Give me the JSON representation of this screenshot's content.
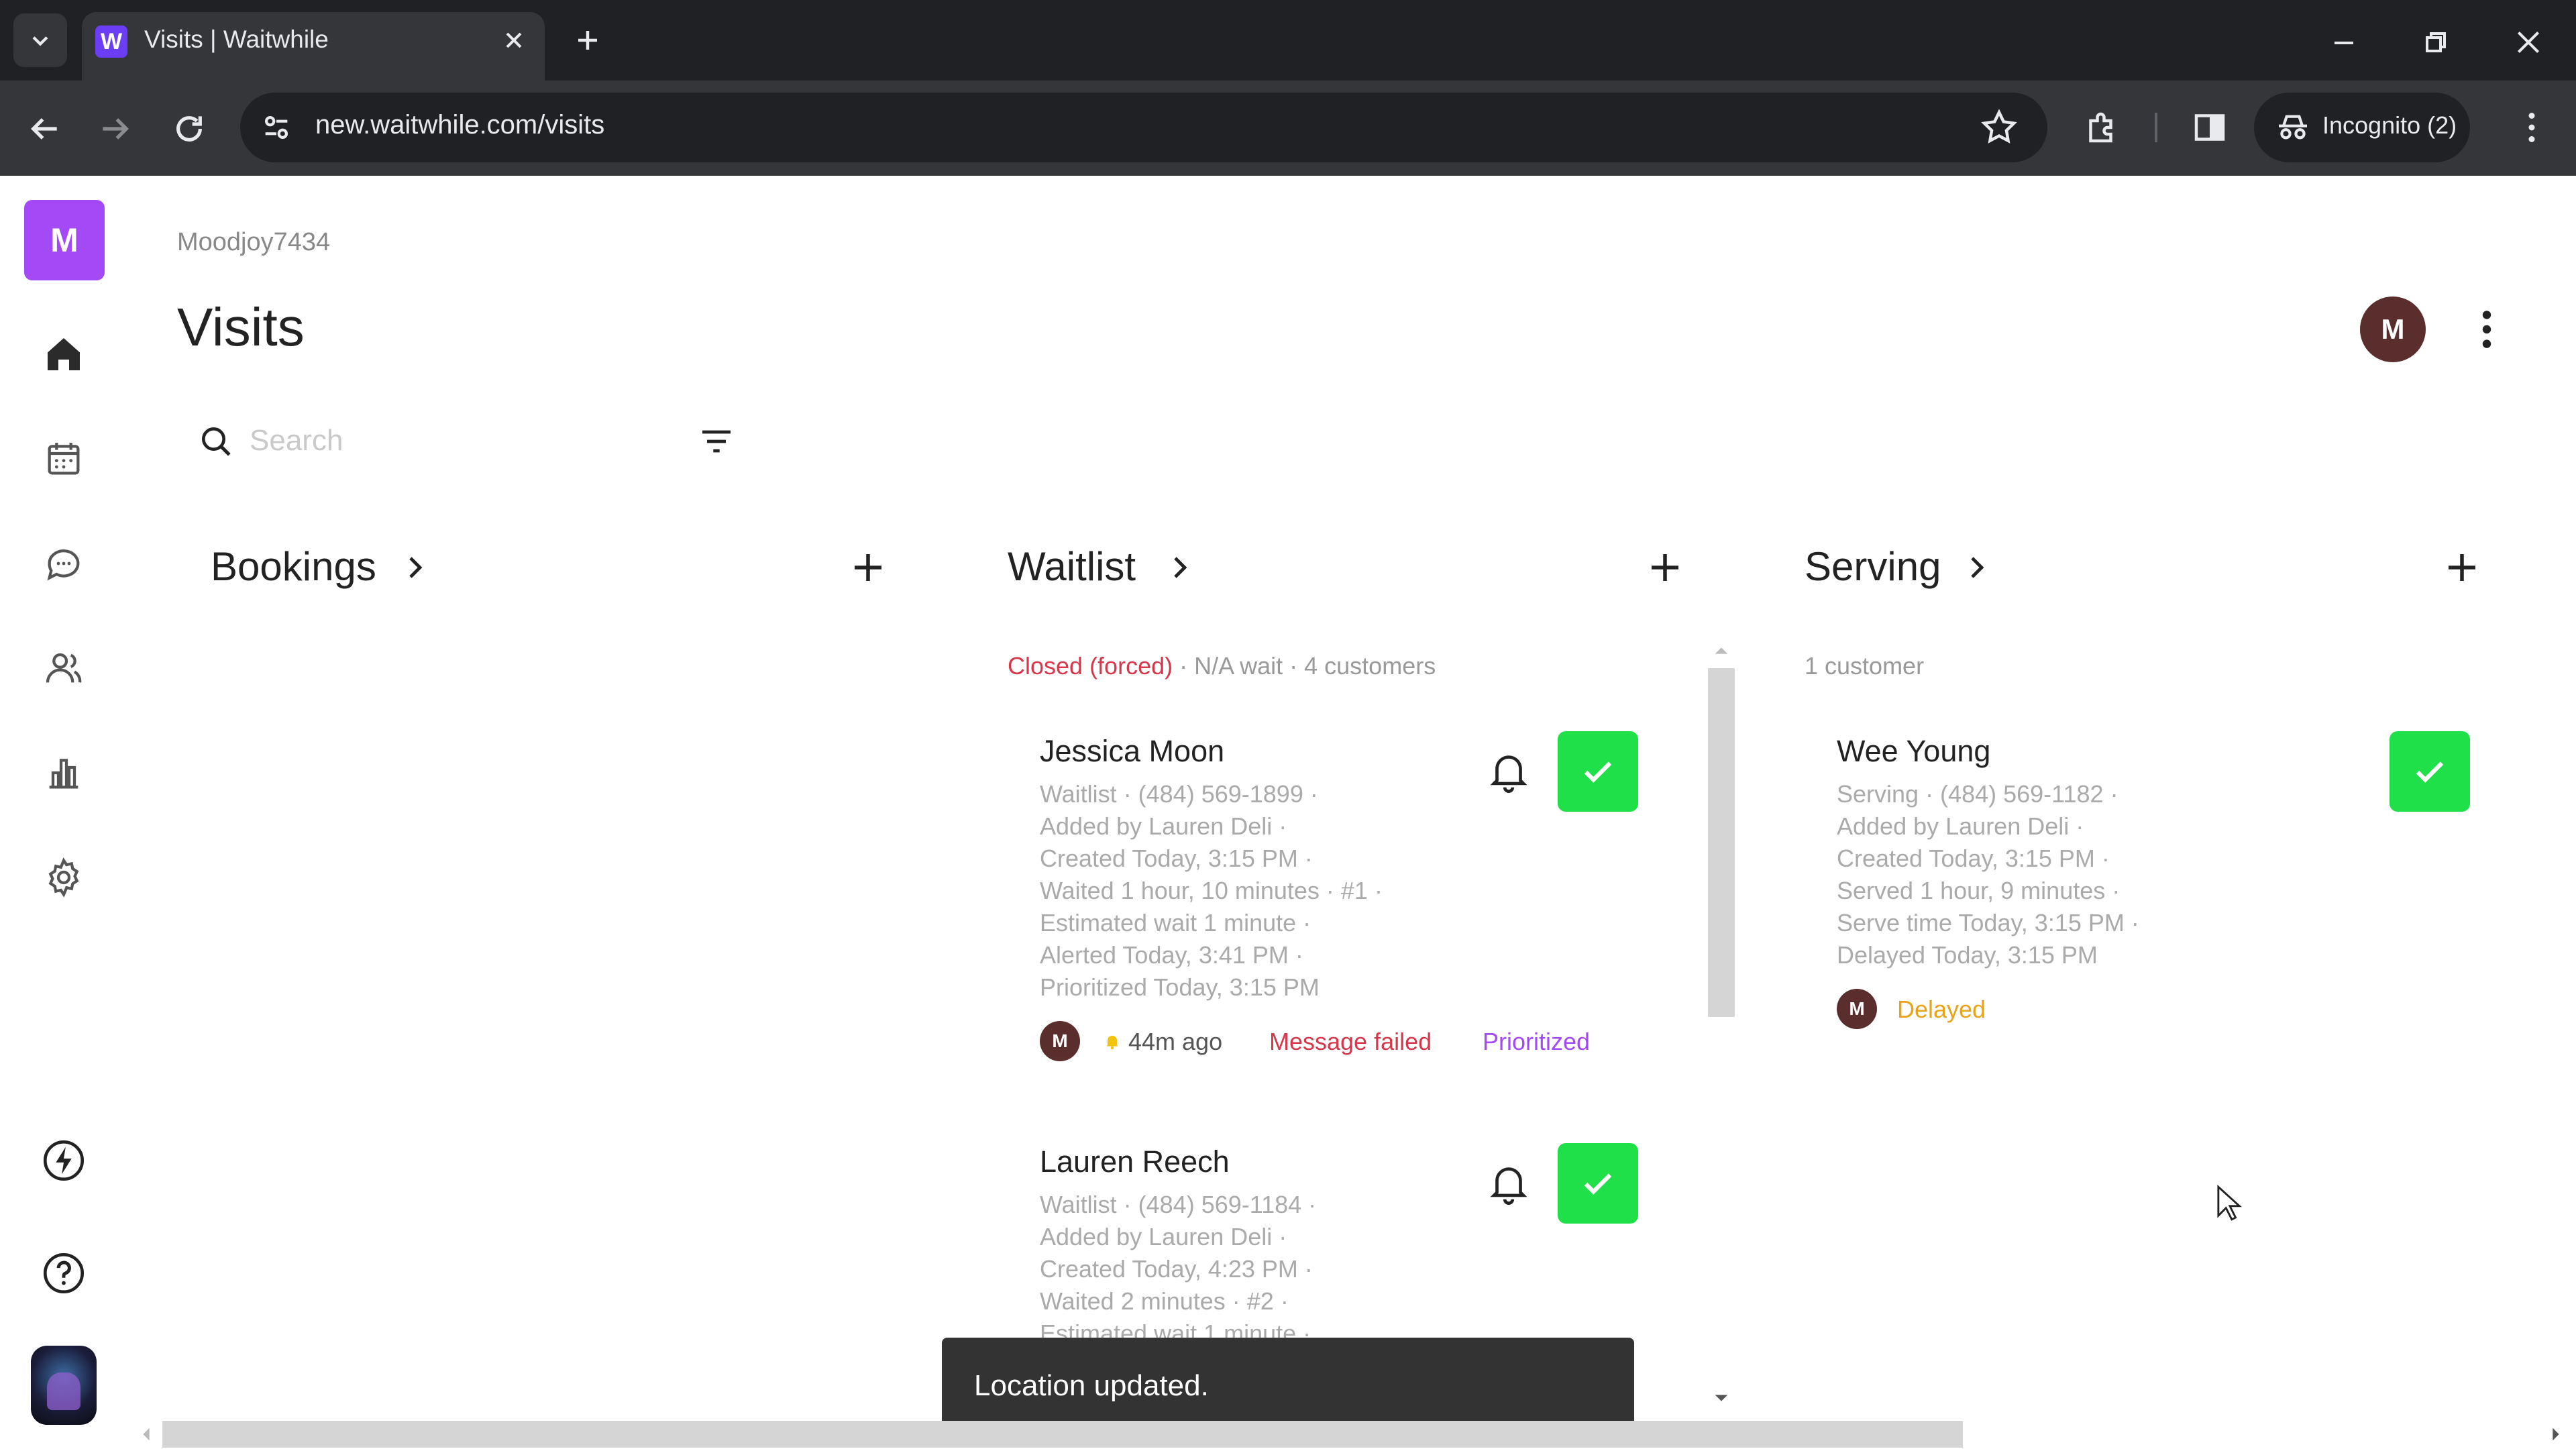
{
  "browser": {
    "tab_title": "Visits | Waitwhile",
    "url": "new.waitwhile.com/visits",
    "incognito_label": "Incognito (2)"
  },
  "sidebar": {
    "logo_letter": "M"
  },
  "header": {
    "account_name": "Moodjoy7434",
    "title": "Visits",
    "avatar_letter": "M"
  },
  "search": {
    "placeholder": "Search"
  },
  "columns": {
    "bookings": {
      "title": "Bookings"
    },
    "waitlist": {
      "title": "Waitlist",
      "status_closed": "Closed (forced)",
      "status_rest": "· N/A wait · 4 customers",
      "cards": [
        {
          "name": "Jessica Moon",
          "lines": [
            "Waitlist · (484) 569-1899 ·",
            "Added by Lauren Deli ·",
            "Created Today, 3:15 PM ·",
            "Waited 1 hour, 10 minutes · #1 ·",
            "Estimated wait 1 minute ·",
            "Alerted Today, 3:41 PM ·",
            "Prioritized Today, 3:15 PM"
          ],
          "avatar_letter": "M",
          "alert_time": "44m ago",
          "message_status": "Message failed",
          "tag": "Prioritized"
        },
        {
          "name": "Lauren Reech",
          "lines": [
            "Waitlist · (484) 569-1184 ·",
            "Added by Lauren Deli ·",
            "Created Today, 4:23 PM ·",
            "Waited 2 minutes · #2 ·",
            "Estimated wait 1 minute ·"
          ]
        }
      ]
    },
    "serving": {
      "title": "Serving",
      "count": "1 customer",
      "cards": [
        {
          "name": "Wee Young",
          "lines": [
            "Serving · (484) 569-1182 ·",
            "Added by Lauren Deli ·",
            "Created Today, 3:15 PM ·",
            "Served 1 hour, 9 minutes ·",
            "Serve time Today, 3:15 PM ·",
            "Delayed Today, 3:15 PM"
          ],
          "avatar_letter": "M",
          "tag": "Delayed"
        }
      ]
    }
  },
  "toast": {
    "message": "Location updated."
  },
  "colors": {
    "brand": "#a349f5",
    "check": "#1fe049",
    "error": "#d7374a",
    "prioritized": "#a349f5",
    "delayed": "#e8a317"
  }
}
